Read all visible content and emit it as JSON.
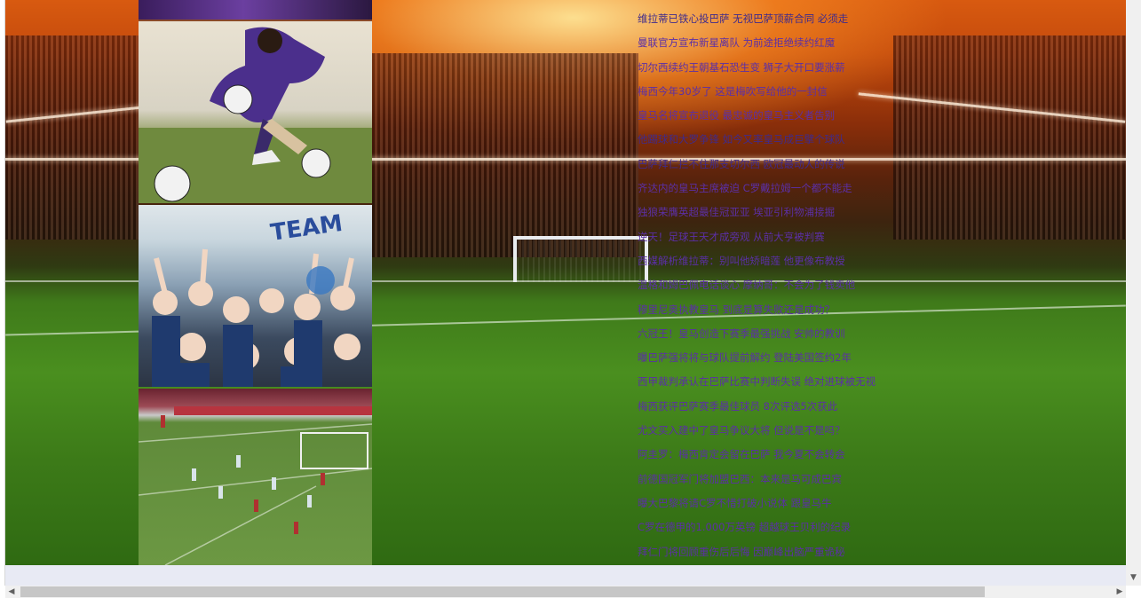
{
  "news": [
    "维拉蒂已铁心投巴萨 无视巴萨顶薪合同 必须走",
    "曼联官方宣布新星离队 为前途拒绝续约红魔",
    "切尔西续约王朝基石恐生变 狮子大开口要涨薪",
    "梅西今年30岁了 这是梅吹写给他的一封信",
    "皇马名将宣布退役 最忠诚的皇马主义者告别",
    "他踢球和大罗争锋 如今又率皇马成巨擘个球队",
    "巴萨拜仁拦不住那支切尔西 欧冠最动人的传说",
    "齐达内的皇马主席被迫 C罗戴拉姆一个都不能走",
    "独狼荣膺英超最佳冠亚亚 埃亚引利物浦接掘",
    "逆天！足球王天才成旁观 从前大亨被判赛",
    "西媒解析维拉蒂：别叫他矫暗莲 他更像布教授",
    "温格和姆巴佩电话谈心 摩纳哥：不会为了钱卖他",
    "穆里尼奥执教皇马 到底是算失败还是成功？",
    "六冠王！皇马创造下赛季最强挑战 安帅的教训",
    "曝巴萨强将将与球队提前解约 登陆美国签约2年",
    "西甲裁判承认在巴萨比赛中判断失误 绝对进球被无视",
    "梅西获评巴萨赛季最佳球员 8次评选5次获此",
    "尤文买入建中了皇马争议大将 但说是不是吗？",
    "阿圭罗：梅西肯定会留在巴萨 我今夏不会转会",
    "前德国冠军门将加盟巴西：本来是马可成巴宾",
    "曝大巴黎将请C罗不惜打破小说体 跟皇马牛",
    "C罗在德甲的1.000万英镑 超越球王贝利的纪录",
    "拜仁门将回顾重伤后后悔 因巅峰出脑严重诡秘"
  ],
  "visited": [
    0,
    5,
    6
  ]
}
